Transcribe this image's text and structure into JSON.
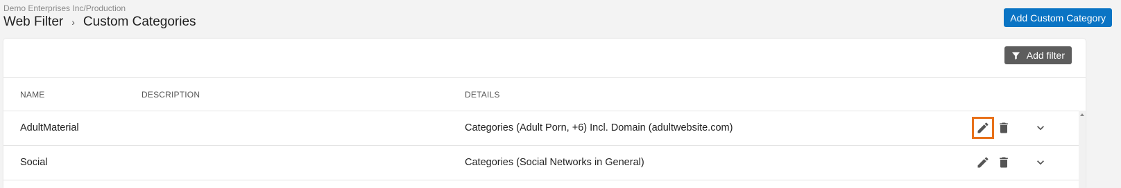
{
  "header": {
    "org_path": "Demo Enterprises Inc/Production",
    "breadcrumb": [
      "Web Filter",
      "Custom Categories"
    ],
    "breadcrumb_separator": "›",
    "add_button_label": "Add Custom Category"
  },
  "toolbar": {
    "filter_button_label": "Add filter",
    "filter_icon": "filter-icon"
  },
  "table": {
    "columns": [
      "NAME",
      "DESCRIPTION",
      "DETAILS"
    ],
    "rows": [
      {
        "name": "AdultMaterial",
        "description": "",
        "details": "Categories (Adult Porn, +6) Incl. Domain (adultwebsite.com)"
      },
      {
        "name": "Social",
        "description": "",
        "details": "Categories (Social Networks in General)"
      }
    ],
    "row_icons": [
      "pencil-icon",
      "trash-icon",
      "chevron-down-icon"
    ]
  },
  "colors": {
    "primary": "#0a74c4",
    "filter_button": "#5d5d5d",
    "focus_outline": "#e8711a",
    "background": "#f3f3f3"
  }
}
